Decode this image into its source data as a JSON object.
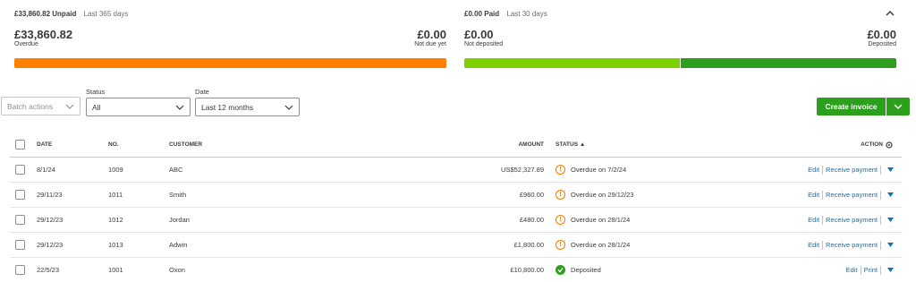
{
  "unpaid": {
    "amount_label": "£33,860.82 Unpaid",
    "period": "Last 365 days",
    "overdue_amount": "£33,860.82",
    "overdue_label": "Overdue",
    "not_due_amount": "£0.00",
    "not_due_label": "Not due yet",
    "overdue_color": "#ff8000"
  },
  "paid": {
    "amount_label": "£0.00 Paid",
    "period": "Last 30 days",
    "not_deposited_amount": "£0.00",
    "not_deposited_label": "Not deposited",
    "deposited_amount": "£0.00",
    "deposited_label": "Deposited",
    "not_deposited_color": "#7fd000",
    "deposited_color": "#2ca01c"
  },
  "filters": {
    "batch_actions": "Batch actions",
    "status_label": "Status",
    "status_value": "All",
    "date_label": "Date",
    "date_value": "Last 12 months"
  },
  "create_invoice": "Create invoice",
  "table": {
    "headers": {
      "date": "DATE",
      "no": "NO.",
      "customer": "CUSTOMER",
      "amount": "AMOUNT",
      "status": "STATUS ▲",
      "action": "ACTION"
    },
    "rows": [
      {
        "date": "8/1/24",
        "no": "1009",
        "customer": "ABC",
        "amount": "US$52,327.89",
        "status": "Overdue on 7/2/24",
        "status_type": "overdue",
        "action1": "Edit",
        "action2": "Receive payment"
      },
      {
        "date": "29/11/23",
        "no": "1011",
        "customer": "Smith",
        "amount": "£960.00",
        "status": "Overdue on 29/12/23",
        "status_type": "overdue",
        "action1": "Edit",
        "action2": "Receive payment"
      },
      {
        "date": "29/12/23",
        "no": "1012",
        "customer": "Jordan",
        "amount": "£480.00",
        "status": "Overdue on 28/1/24",
        "status_type": "overdue",
        "action1": "Edit",
        "action2": "Receive payment"
      },
      {
        "date": "29/12/23",
        "no": "1013",
        "customer": "Adwin",
        "amount": "£1,800.00",
        "status": "Overdue on 28/1/24",
        "status_type": "overdue",
        "action1": "Edit",
        "action2": "Receive payment"
      },
      {
        "date": "22/5/23",
        "no": "1001",
        "customer": "Oxon",
        "amount": "£10,800.00",
        "status": "Deposited",
        "status_type": "deposited",
        "action1": "Edit",
        "action2": "Print"
      }
    ]
  }
}
